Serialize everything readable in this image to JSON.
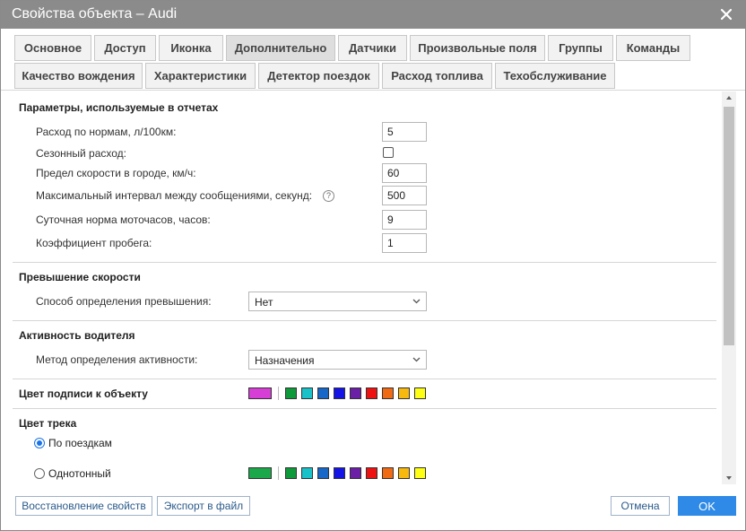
{
  "window": {
    "title": "Свойства объекта – Audi"
  },
  "tabs": [
    {
      "label": "Основное"
    },
    {
      "label": "Доступ"
    },
    {
      "label": "Иконка"
    },
    {
      "label": "Дополнительно",
      "active": true
    },
    {
      "label": "Датчики"
    },
    {
      "label": "Произвольные поля"
    },
    {
      "label": "Группы"
    },
    {
      "label": "Команды"
    },
    {
      "label": "Качество вождения"
    },
    {
      "label": "Характеристики"
    },
    {
      "label": "Детектор поездок"
    },
    {
      "label": "Расход топлива"
    },
    {
      "label": "Техобслуживание"
    }
  ],
  "report_params": {
    "title": "Параметры, используемые в отчетах",
    "fuel_norm": {
      "label": "Расход по нормам, л/100км:",
      "value": "5"
    },
    "seasonal": {
      "label": "Сезонный расход:",
      "checked": false
    },
    "city_speed": {
      "label": "Предел скорости в городе, км/ч:",
      "value": "60"
    },
    "max_interval": {
      "label": "Максимальный интервал между сообщениями, секунд:",
      "value": "500",
      "help": "?"
    },
    "engine_hours": {
      "label": "Суточная норма моточасов, часов:",
      "value": "9"
    },
    "mileage_coef": {
      "label": "Коэффициент пробега:",
      "value": "1"
    }
  },
  "speeding": {
    "title": "Превышение скорости",
    "method": {
      "label": "Способ определения превышения:",
      "value": "Нет"
    }
  },
  "driver_activity": {
    "title": "Активность водителя",
    "method": {
      "label": "Метод определения активности:",
      "value": "Назначения"
    }
  },
  "label_color": {
    "title": "Цвет подписи к объекту",
    "selected": "#d63ed6"
  },
  "track_color": {
    "title": "Цвет трека",
    "by_trips": {
      "label": "По поездкам",
      "checked": true
    },
    "mono": {
      "label": "Однотонный",
      "checked": false
    },
    "selected": "#1aa84a"
  },
  "palette": [
    "#0e9a3a",
    "#19c2c8",
    "#1767c9",
    "#1414e6",
    "#6a1fa6",
    "#ee1111",
    "#f06a14",
    "#f7b90e",
    "#ffff14"
  ],
  "footer": {
    "restore": "Восстановление свойств",
    "export": "Экспорт в файл",
    "cancel": "Отмена",
    "ok": "OK"
  }
}
